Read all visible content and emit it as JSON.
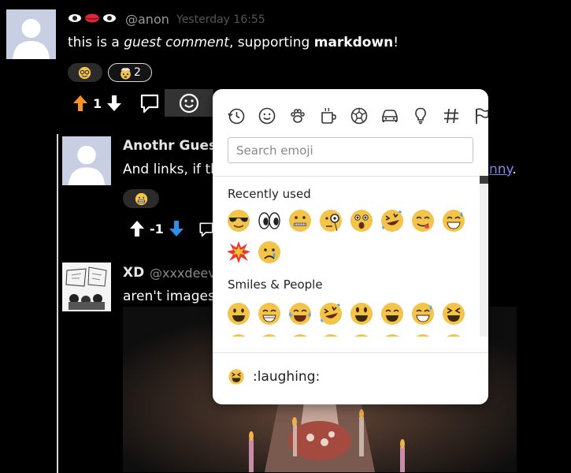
{
  "comments": [
    {
      "username": "@anon",
      "timestamp": "Yesterday 16:55",
      "body": {
        "prefix": "this is a ",
        "italic": "guest comment",
        "middle": ", supporting ",
        "bold": "markdown",
        "suffix": "!"
      },
      "reactions": [
        {
          "count": ""
        },
        {
          "count": "2"
        }
      ],
      "score": "1"
    },
    {
      "name": "Anothr Guest",
      "body_start": "And links, if th",
      "link_fragment": "nny",
      "period": ".",
      "score": "-1"
    },
    {
      "name": "XD",
      "username": "@xxxdeev",
      "body_start": "aren't images"
    }
  ],
  "picker": {
    "categories": [
      "recent-icon",
      "smileys-icon",
      "animals-icon",
      "food-icon",
      "activities-icon",
      "travel-icon",
      "objects-icon",
      "symbols-icon",
      "flags-icon"
    ],
    "search_placeholder": "Search emoji",
    "sections": [
      {
        "title": "Recently used",
        "emojis": [
          "😎",
          "👀",
          "🤐",
          "🧐",
          "😲",
          "🤣",
          "😋",
          "😅",
          "💥",
          "😢"
        ]
      },
      {
        "title": "Smiles & People",
        "emojis": [
          "😀",
          "😁",
          "😂",
          "🤣",
          "😃",
          "😄",
          "😅",
          "😆"
        ]
      }
    ],
    "preview_label": ":laughing:"
  },
  "colors": {
    "upvote": "#f7931e",
    "downvote": "#2d8fe8",
    "link": "#8a8cf0",
    "emoji_yellow": "#f3c34a"
  }
}
